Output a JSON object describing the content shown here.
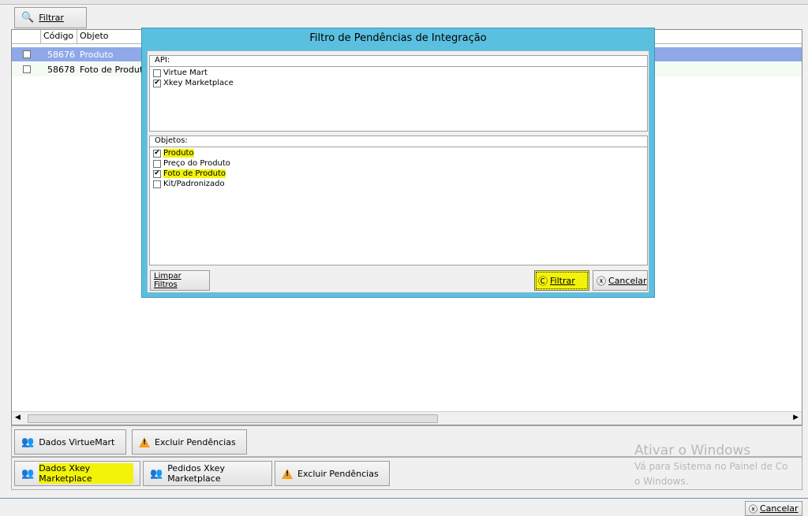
{
  "toolbar": {
    "filter_label": "Filtrar"
  },
  "grid": {
    "columns": [
      "Código",
      "Objeto"
    ],
    "rows": [
      {
        "code": "58676",
        "object": "Produto",
        "selected": true
      },
      {
        "code": "58678",
        "object": "Foto de Produt",
        "selected": false
      }
    ]
  },
  "dialog": {
    "title": "Filtro de Pendências de Integração",
    "api_label": "API:",
    "api_items": [
      {
        "label": "Virtue Mart",
        "checked": false
      },
      {
        "label": "Xkey Marketplace",
        "checked": true
      }
    ],
    "objects_label": "Objetos:",
    "object_items": [
      {
        "label": "Produto",
        "checked": true,
        "highlight": true
      },
      {
        "label": "Preço do Produto",
        "checked": false,
        "highlight": false
      },
      {
        "label": "Foto de Produto",
        "checked": true,
        "highlight": true
      },
      {
        "label": "Kit/Padronizado",
        "checked": false,
        "highlight": false
      }
    ],
    "clear_label": "Limpar Filtros",
    "filter_label": "Filtrar",
    "cancel_label": "Cancelar"
  },
  "bottom": {
    "row1": {
      "data_label": "Dados VirtueMart",
      "delete_label": "Excluir Pendências"
    },
    "row2": {
      "data_label": "Dados Xkey Marketplace",
      "orders_label": "Pedidos Xkey Marketplace",
      "delete_label": "Excluir Pendências"
    },
    "cancel_label": "Cancelar"
  },
  "watermark": {
    "title": "Ativar o Windows",
    "line1": "Vá para Sistema no Painel de Co",
    "line2": "o Windows."
  },
  "colors": {
    "dialog_border": "#5bc0e0",
    "selected_row": "#8fa8e8",
    "highlight": "#f3f30a"
  }
}
